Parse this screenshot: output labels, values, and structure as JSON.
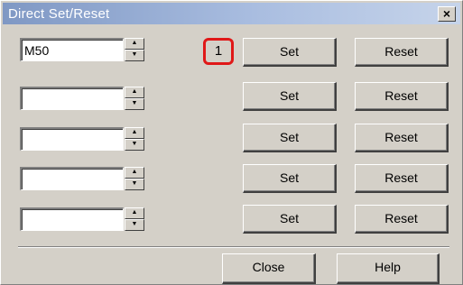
{
  "window": {
    "title": "Direct Set/Reset",
    "close_glyph": "×"
  },
  "counter": "1",
  "rows": [
    {
      "value": "M50",
      "set_label": "Set",
      "reset_label": "Reset"
    },
    {
      "value": "",
      "set_label": "Set",
      "reset_label": "Reset"
    },
    {
      "value": "",
      "set_label": "Set",
      "reset_label": "Reset"
    },
    {
      "value": "",
      "set_label": "Set",
      "reset_label": "Reset"
    },
    {
      "value": "",
      "set_label": "Set",
      "reset_label": "Reset"
    }
  ],
  "spinner": {
    "up_glyph": "▲",
    "down_glyph": "▼"
  },
  "footer": {
    "close_label": "Close",
    "help_label": "Help"
  },
  "colors": {
    "titlebar_start": "#7f98c4",
    "titlebar_end": "#c6d4ea",
    "highlight": "#e01818",
    "face": "#d4d0c8"
  }
}
